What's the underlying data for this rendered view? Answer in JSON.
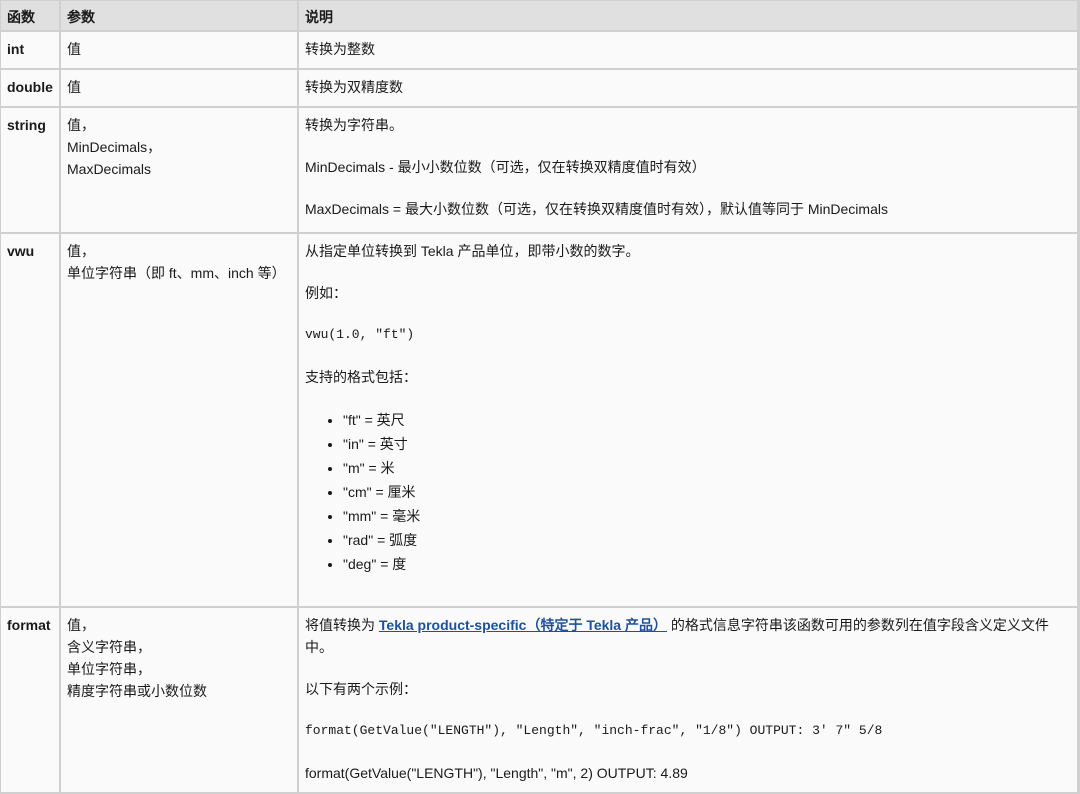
{
  "headers": {
    "function": "函数",
    "params": "参数",
    "desc": "说明"
  },
  "rows": {
    "int": {
      "name": "int",
      "param1": "值",
      "desc1": "转换为整数"
    },
    "double": {
      "name": "double",
      "param1": "值",
      "desc1": "转换为双精度数"
    },
    "string": {
      "name": "string",
      "param1": "值，",
      "param2": "MinDecimals，",
      "param3": "MaxDecimals",
      "desc1": "转换为字符串。",
      "desc2": "MinDecimals - 最小小数位数（可选，仅在转换双精度值时有效）",
      "desc3": "MaxDecimals = 最大小数位数（可选，仅在转换双精度值时有效），默认值等同于 MinDecimals"
    },
    "vwu": {
      "name": "vwu",
      "param1": "值，",
      "param2": "单位字符串（即 ft、mm、inch 等）",
      "desc1": "从指定单位转换到 Tekla 产品单位，即带小数的数字。",
      "desc2": "例如：",
      "example": "vwu(1.0, \"ft\")",
      "desc3": "支持的格式包括：",
      "formats": [
        "\"ft\" = 英尺",
        "\"in\" = 英寸",
        "\"m\" = 米",
        "\"cm\" = 厘米",
        "\"mm\" = 毫米",
        "\"rad\" = 弧度",
        "\"deg\" = 度"
      ]
    },
    "format": {
      "name": "format",
      "param1": "值，",
      "param2": "含义字符串，",
      "param3": "单位字符串，",
      "param4": "精度字符串或小数位数",
      "desc1_pre": "将值转换为 ",
      "desc1_link": "Tekla product-specific（特定于 Tekla 产品）",
      "desc1_post": " 的格式信息字符串该函数可用的参数列在值字段含义定义文件中。",
      "desc2": "以下有两个示例：",
      "example1": "format(GetValue(\"LENGTH\"), \"Length\", \"inch-frac\", \"1/8\") OUTPUT: 3' 7\" 5/8",
      "example2": "format(GetValue(\"LENGTH\"), \"Length\", \"m\", 2) OUTPUT: 4.89"
    }
  }
}
